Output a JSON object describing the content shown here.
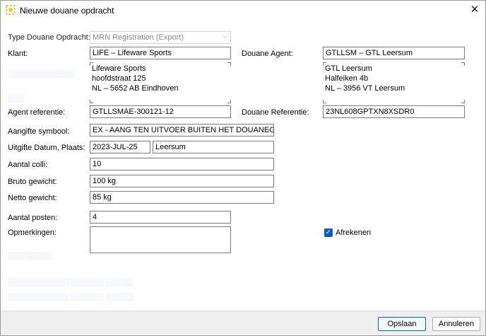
{
  "window": {
    "title": "Nieuwe douane opdracht"
  },
  "form": {
    "type_label": "Type Douane Opdracht:",
    "type_value": "MRN Registration (Export)",
    "klant_label": "Klant:",
    "klant_value": "LIFE – Lifeware Sports",
    "klant_address": [
      "Lifeware Sports",
      "hoofdstraat 125",
      "NL – 5652 AB Eindhoven"
    ],
    "agent_label": "Douane Agent:",
    "agent_value": "GTLLSM – GTL Leersum",
    "agent_address": [
      "GTL Leersum",
      "Halfeiken 4b",
      "NL – 3956 VT Leersum"
    ],
    "agent_ref_label": "Agent referentie:",
    "agent_ref_value": "GTLLSMAE-300121-12",
    "douane_ref_label": "Douane Referentie:",
    "douane_ref_value": "23NL608GPTXN8XSDR0",
    "aangifte_label": "Aangifte symbool:",
    "aangifte_value": "EX - AANG TEN UITVOER BUITEN HET DOUANEGEBI...",
    "uitgifte_label": "Uitgifte Datum, Plaats:",
    "uitgifte_date": "2023-JUL-25",
    "uitgifte_place": "Leersum",
    "colli_label": "Aantal colli:",
    "colli_value": "10",
    "bruto_label": "Bruto gewicht:",
    "bruto_value": "100 kg",
    "netto_label": "Netto gewicht:",
    "netto_value": "85 kg",
    "posten_label": "Aantal posten:",
    "posten_value": "4",
    "opmerkingen_label": "Opmerkingen:",
    "opmerkingen_value": "",
    "afrekenen_label": "Afrekenen",
    "afrekenen_checked": true
  },
  "buttons": {
    "save": "Opslaan",
    "cancel": "Annuleren"
  },
  "colors": {
    "accent": "#0067c0",
    "checkbox": "#0b5cc9"
  }
}
